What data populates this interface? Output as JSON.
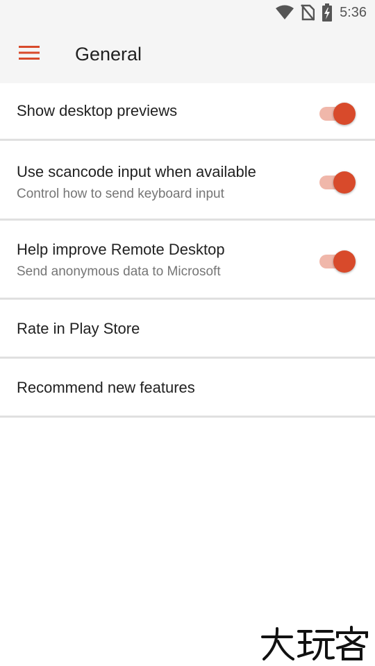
{
  "status_bar": {
    "time": "5:36",
    "icons": [
      "wifi-icon",
      "no-sim-icon",
      "battery-charging-icon"
    ]
  },
  "app_bar": {
    "title": "General",
    "menu_icon": "hamburger-menu-icon",
    "accent_color": "#d84a2b"
  },
  "settings": [
    {
      "title": "Show desktop previews",
      "subtitle": "",
      "toggle": true
    },
    {
      "title": "Use scancode input when available",
      "subtitle": "Control how to send keyboard input",
      "toggle": true
    },
    {
      "title": "Help improve Remote Desktop",
      "subtitle": "Send anonymous data to Microsoft",
      "toggle": true
    },
    {
      "title": "Rate in Play Store",
      "subtitle": ""
    },
    {
      "title": "Recommend new features",
      "subtitle": ""
    }
  ],
  "colors": {
    "switch_thumb": "#d84a2b",
    "switch_track": "#f0b7aa",
    "divider": "#e0e0e0",
    "app_bar_bg": "#f5f5f5"
  },
  "watermark": {
    "text": "大玩客"
  }
}
